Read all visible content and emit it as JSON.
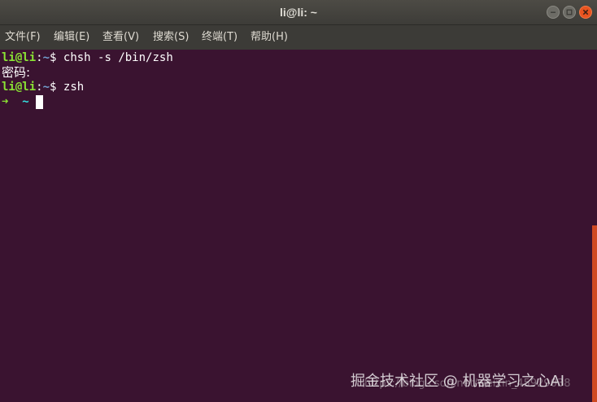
{
  "window": {
    "title": "li@li: ~",
    "controls": {
      "minimize_icon": "minimize-icon",
      "maximize_icon": "maximize-icon",
      "close_icon": "close-icon"
    }
  },
  "menubar": {
    "items": [
      {
        "label": "文件(F)"
      },
      {
        "label": "编辑(E)"
      },
      {
        "label": "查看(V)"
      },
      {
        "label": "搜索(S)"
      },
      {
        "label": "终端(T)"
      },
      {
        "label": "帮助(H)"
      }
    ]
  },
  "terminal": {
    "lines": [
      {
        "user": "li@li",
        "sep": ":",
        "path": "~",
        "prompt": "$ ",
        "command": "chsh -s /bin/zsh"
      },
      {
        "text": "密码:"
      },
      {
        "user": "li@li",
        "sep": ":",
        "path": "~",
        "prompt": "$ ",
        "command": "zsh"
      },
      {
        "arrow": "➜",
        "tilde": "~"
      }
    ]
  },
  "watermark": {
    "text": "掘金技术社区 @ 机器学习之心AI",
    "url": "https://blog.csdn.net/weixin_45929038"
  },
  "colors": {
    "background": "#3a1330",
    "prompt_user": "#8ae234",
    "prompt_path": "#729fcf",
    "zsh_tilde": "#34e2e2",
    "scrollbar": "#e95420",
    "close_button": "#e95420"
  }
}
